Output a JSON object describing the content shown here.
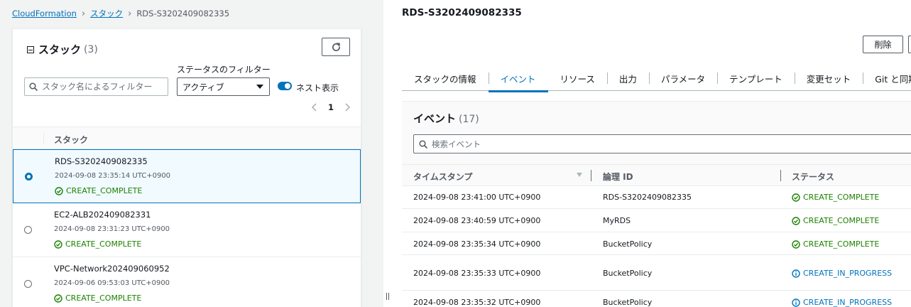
{
  "breadcrumb": [
    {
      "label": "CloudFormation",
      "link": true
    },
    {
      "label": "スタック",
      "link": true
    },
    {
      "label": "RDS-S3202409082335",
      "link": false
    }
  ],
  "stacks_panel": {
    "title": "スタック",
    "count": "(3)",
    "status_filter_label": "ステータスのフィルター",
    "search_placeholder": "スタック名によるフィルター",
    "status_filter_value": "アクティブ",
    "nest_label": "ネスト表示",
    "nest_enabled": true,
    "page": "1",
    "column_header": "スタック",
    "rows": [
      {
        "name": "RDS-S3202409082335",
        "time": "2024-09-08 23:35:14 UTC+0900",
        "status": "CREATE_COMPLETE",
        "selected": true
      },
      {
        "name": "EC2-ALB202409082331",
        "time": "2024-09-08 23:31:23 UTC+0900",
        "status": "CREATE_COMPLETE",
        "selected": false
      },
      {
        "name": "VPC-Network202409060952",
        "time": "2024-09-06 09:53:03 UTC+0900",
        "status": "CREATE_COMPLETE",
        "selected": false
      }
    ]
  },
  "detail": {
    "title": "RDS-S3202409082335",
    "delete_label": "削除",
    "tabs": [
      {
        "label": "スタックの情報",
        "active": false
      },
      {
        "label": "イベント",
        "active": true
      },
      {
        "label": "リソース",
        "active": false
      },
      {
        "label": "出力",
        "active": false
      },
      {
        "label": "パラメータ",
        "active": false
      },
      {
        "label": "テンプレート",
        "active": false
      },
      {
        "label": "変更セット",
        "active": false
      },
      {
        "label": "Git と同期 - 新規",
        "active": false
      }
    ],
    "events": {
      "title": "イベント",
      "count": "(17)",
      "search_placeholder": "検索イベント",
      "columns": {
        "timestamp": "タイムスタンプ",
        "logical_id": "論理 ID",
        "status": "ステータス"
      },
      "rows": [
        {
          "timestamp": "2024-09-08 23:41:00 UTC+0900",
          "logical_id": "RDS-S3202409082335",
          "status": "CREATE_COMPLETE",
          "kind": "ok"
        },
        {
          "timestamp": "2024-09-08 23:40:59 UTC+0900",
          "logical_id": "MyRDS",
          "status": "CREATE_COMPLETE",
          "kind": "ok"
        },
        {
          "timestamp": "2024-09-08 23:35:34 UTC+0900",
          "logical_id": "BucketPolicy",
          "status": "CREATE_COMPLETE",
          "kind": "ok"
        },
        {
          "timestamp": "2024-09-08 23:35:33 UTC+0900",
          "logical_id": "BucketPolicy",
          "status": "CREATE_IN_PROGRESS",
          "kind": "prog"
        },
        {
          "timestamp": "2024-09-08 23:35:32 UTC+0900",
          "logical_id": "BucketPolicy",
          "status": "CREATE_IN_PROGRESS",
          "kind": "prog"
        }
      ]
    }
  },
  "colors": {
    "accent": "#0073bb",
    "success": "#1d8102",
    "border": "#eaeded"
  },
  "icons": {
    "refresh": "refresh-icon",
    "search": "search-icon",
    "success": "check-circle-icon",
    "in_progress": "info-circle-icon"
  }
}
